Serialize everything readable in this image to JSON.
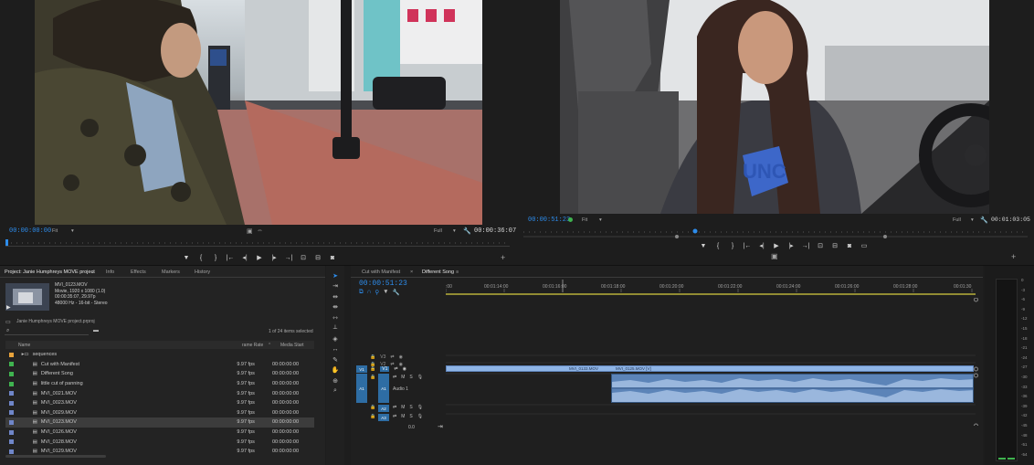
{
  "source_monitor": {
    "timecode": "00:00:00:00",
    "fit": "Fit",
    "quality": "Full",
    "duration": "00:00:36:07"
  },
  "program_monitor": {
    "timecode": "00:00:51:23",
    "fit": "Fit",
    "quality": "Full",
    "duration": "00:01:03:05"
  },
  "project_panel": {
    "tabs": [
      "Project: Janie Humphreys MOVE project",
      "Info",
      "Effects",
      "Markers",
      "History"
    ],
    "preview": {
      "name": "MVI_0123.MOV",
      "line1": "Movie, 1920 x 1080 (1.0)",
      "line2": "00:00:35:07, 29.97p",
      "line3": "48000 Hz - 16-bit - Stereo"
    },
    "project_file": "Janie Humphreys MOVE project.prproj",
    "item_count": "1 of 24 items selected",
    "columns": {
      "name": "Name",
      "frame_rate": "rame Rate",
      "media_start": "Media Start"
    },
    "items": [
      {
        "name": "sequences",
        "rate": "",
        "start": "",
        "color": "#e8a33c",
        "indent": 0,
        "sel": false
      },
      {
        "name": "Cut with Manifest",
        "rate": "9.97 fps",
        "start": "00:00:00:00",
        "color": "#3fb34f",
        "indent": 1,
        "sel": false
      },
      {
        "name": "Different Song",
        "rate": "9.97 fps",
        "start": "00:00:00:00",
        "color": "#3fb34f",
        "indent": 1,
        "sel": false
      },
      {
        "name": "little cut of panning",
        "rate": "9.97 fps",
        "start": "00:00:00:00",
        "color": "#3fb34f",
        "indent": 1,
        "sel": false
      },
      {
        "name": "MVI_0021.MOV",
        "rate": "9.97 fps",
        "start": "00:00:00:00",
        "color": "#6f86c9",
        "indent": 1,
        "sel": false
      },
      {
        "name": "MVI_0023.MOV",
        "rate": "9.97 fps",
        "start": "00:00:00:00",
        "color": "#6f86c9",
        "indent": 1,
        "sel": false
      },
      {
        "name": "MVI_0029.MOV",
        "rate": "9.97 fps",
        "start": "00:00:00:00",
        "color": "#6f86c9",
        "indent": 1,
        "sel": false
      },
      {
        "name": "MVI_0123.MOV",
        "rate": "9.97 fps",
        "start": "00:00:00:00",
        "color": "#6f86c9",
        "indent": 1,
        "sel": true
      },
      {
        "name": "MVI_0126.MOV",
        "rate": "9.97 fps",
        "start": "00:00:00:00",
        "color": "#6f86c9",
        "indent": 1,
        "sel": false
      },
      {
        "name": "MVI_0128.MOV",
        "rate": "9.97 fps",
        "start": "00:00:00:00",
        "color": "#6f86c9",
        "indent": 1,
        "sel": false
      },
      {
        "name": "MVI_0129.MOV",
        "rate": "9.97 fps",
        "start": "00:00:00:00",
        "color": "#6f86c9",
        "indent": 1,
        "sel": false
      }
    ]
  },
  "timeline": {
    "tabs": [
      "Cut with Manifest",
      "Different Song"
    ],
    "timecode": "00:00:51:23",
    "ruler": [
      ":00",
      "00:01:14:00",
      "00:01:16:00",
      "00:01:18:00",
      "00:01:20:00",
      "00:01:22:00",
      "00:01:24:00",
      "00:01:26:00",
      "00:01:28:00",
      "00:01:30"
    ],
    "tracks": {
      "v3": "V3",
      "v2": "V2",
      "v1": "V1",
      "a1": "A1",
      "a2": "A2",
      "a3": "A3"
    },
    "audio_label": "Audio 1",
    "volume": "0.0",
    "clip1": "MVI_0133.MOV",
    "clip2": "MVI_0125.MOV [V]"
  },
  "meter_scale": [
    "0",
    "-3",
    "-6",
    "-9",
    "-12",
    "-15",
    "-18",
    "-21",
    "-24",
    "-27",
    "-30",
    "-33",
    "-36",
    "-39",
    "-42",
    "-45",
    "-48",
    "-51",
    "-54"
  ],
  "colors": {
    "accent": "#2d8ceb",
    "clip_video": "#8fb5e6",
    "clip_audio": "#6f94c8"
  }
}
